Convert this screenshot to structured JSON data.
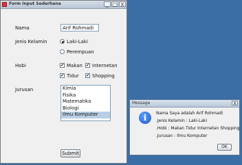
{
  "window": {
    "title": "Form Input Sederhana",
    "title_buttons": [
      "_",
      "□",
      "X"
    ]
  },
  "form": {
    "nama_label": "Nama",
    "nama_value": "Arif Rohmadi",
    "jk_label": "Jenis Kelamin",
    "jk_options": [
      {
        "label": "Laki-Laki",
        "checked": true
      },
      {
        "label": "Perempuan",
        "checked": false
      }
    ],
    "hobi_label": "Hobi",
    "hobi_options": [
      {
        "label": "Makan",
        "checked": true
      },
      {
        "label": "Internetan",
        "checked": true
      },
      {
        "label": "Tidur",
        "checked": true
      },
      {
        "label": "Shopping",
        "checked": true
      }
    ],
    "jurusan_label": "Jurusan",
    "jurusan_items": [
      "Kimia",
      "Fisika",
      "Matematika",
      "Biologi",
      "Ilmu Komputer"
    ],
    "jurusan_selected": "Ilmu Komputer",
    "submit_label": "Submit"
  },
  "dialog": {
    "title": "Message",
    "close": "X",
    "lines": [
      "Nama Saya adalah Arif Rohmadi",
      ".Jenis Kelamin : Laki-Laki",
      ".Hobi : Makan Tidur Internetan Shopping",
      ".Jurusan : Ilmu Komputer"
    ],
    "ok_label": "OK",
    "icon": "information-icon"
  }
}
